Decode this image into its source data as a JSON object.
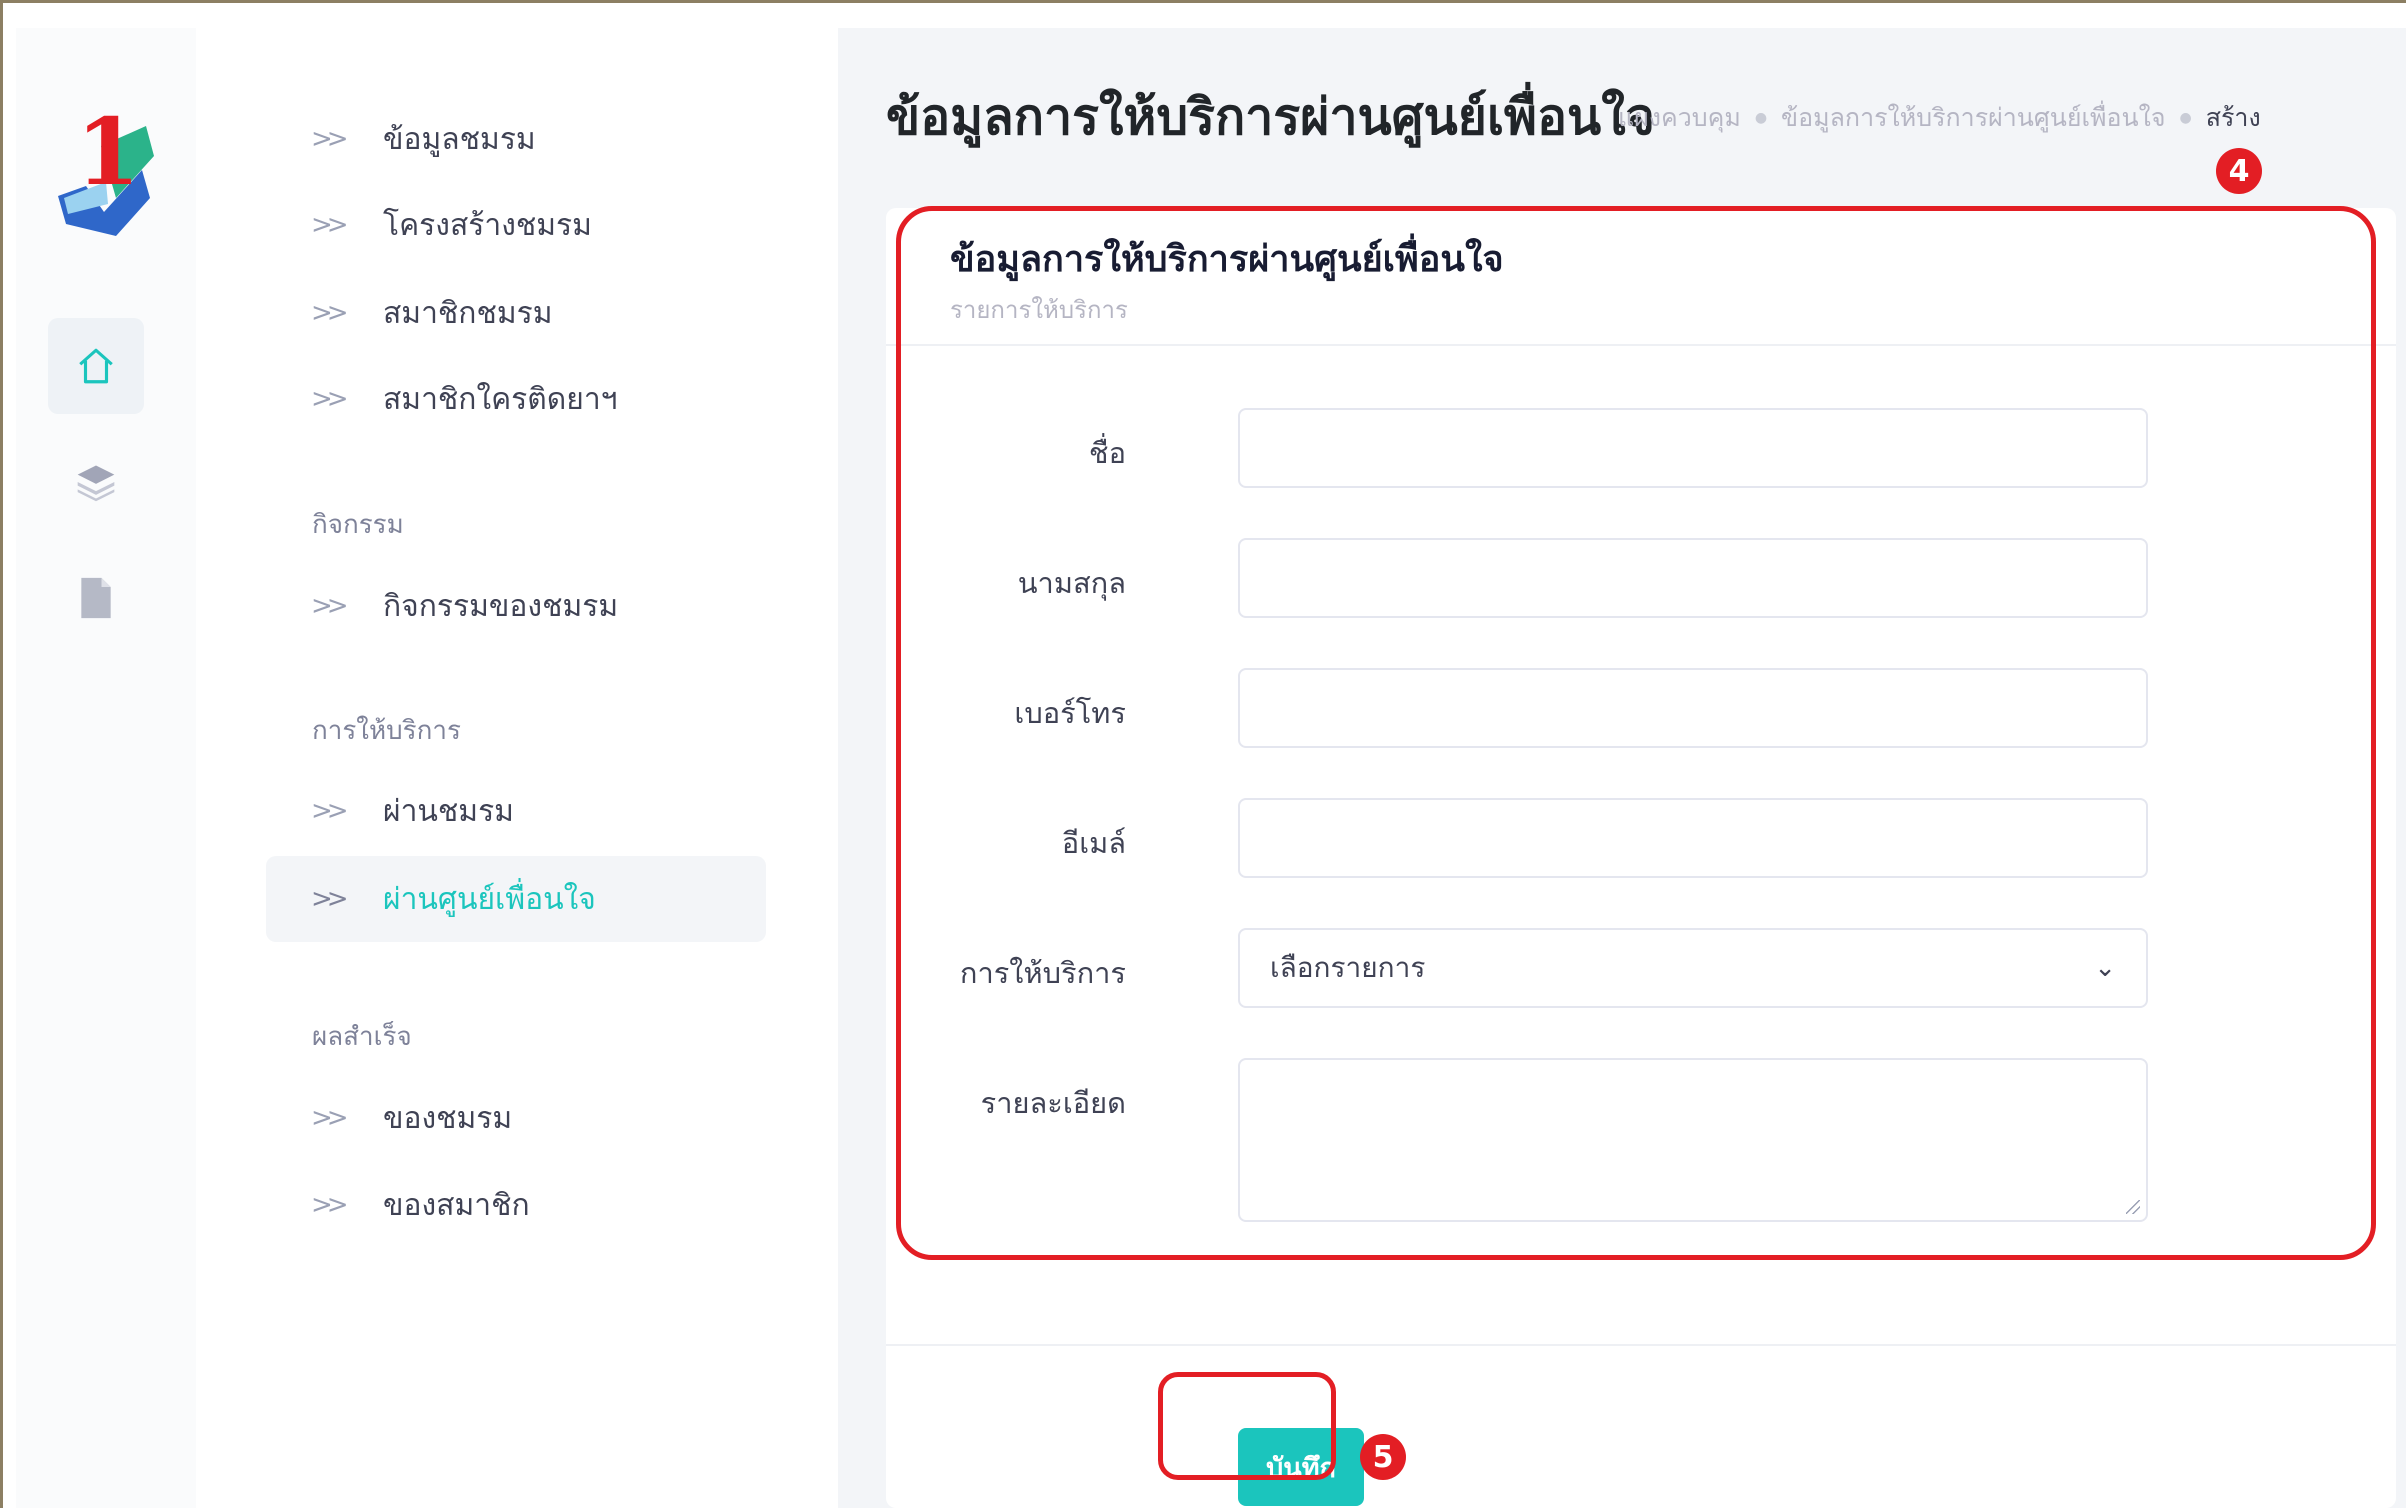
{
  "sidebar": {
    "items": [
      {
        "label": "ข้อมูลชมรม"
      },
      {
        "label": "โครงสร้างชมรม"
      },
      {
        "label": "สมาชิกชมรม"
      },
      {
        "label": "สมาชิกใครติดยาฯ"
      },
      {
        "label": "กิจกรรมของชมรม"
      },
      {
        "label": "ผ่านชมรม"
      },
      {
        "label": "ผ่านศูนย์เพื่อนใจ"
      },
      {
        "label": "ของชมรม"
      },
      {
        "label": "ของสมาชิก"
      }
    ],
    "sections": {
      "activity": "กิจกรรม",
      "service": "การให้บริการ",
      "result": "ผลสำเร็จ"
    },
    "active_item": "ผ่านศูนย์เพื่อนใจ"
  },
  "rail": {
    "icons": [
      "home-icon",
      "layers-icon",
      "file-icon"
    ],
    "active": "home-icon"
  },
  "header": {
    "title": "ข้อมูลการให้บริการผ่านศูนย์เพื่อนใจ",
    "breadcrumb": [
      "แผงควบคุม",
      "ข้อมูลการให้บริการผ่านศูนย์เพื่อนใจ",
      "สร้าง"
    ]
  },
  "card": {
    "title": "ข้อมูลการให้บริการผ่านศูนย์เพื่อนใจ",
    "subtitle": "รายการให้บริการ"
  },
  "form": {
    "first_name_label": "ชื่อ",
    "first_name_value": "",
    "last_name_label": "นามสกุล",
    "last_name_value": "",
    "phone_label": "เบอร์โทร",
    "phone_value": "",
    "email_label": "อีเมล์",
    "email_value": "",
    "service_label": "การให้บริการ",
    "service_selected": "เลือกรายการ",
    "detail_label": "รายละเอียด",
    "detail_value": ""
  },
  "actions": {
    "save_label": "บันทึก"
  },
  "annotations": {
    "badge_4": "4",
    "badge_5": "5",
    "highlight_color": "#e31e24"
  },
  "colors": {
    "accent": "#1bc5bd",
    "annotation": "#e31e24"
  }
}
